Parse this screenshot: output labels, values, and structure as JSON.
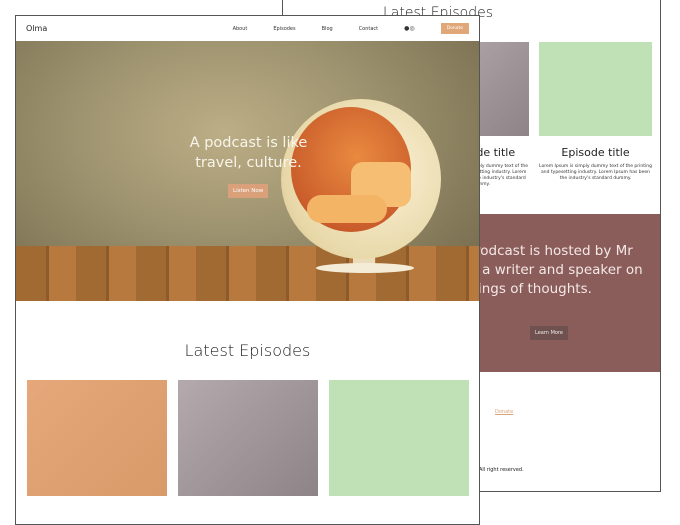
{
  "back_page": {
    "latest_title": "Latest Episodes",
    "episodes": [
      {
        "title": "Episode title",
        "desc": "Lorem Ipsum is simply dummy text of the printing and typesetting industry. Lorem Ipsum has been the industry's standard dummy."
      },
      {
        "title": "Episode title",
        "desc": "Lorem Ipsum is simply dummy text of the printing and typesetting industry. Lorem Ipsum has been the industry's standard dummy."
      }
    ],
    "about_text": "The Olma Podcast is hosted by Mr Name and is a writer and speaker on all things of thoughts.",
    "learn_more": "Learn More",
    "donate_link": "Donate",
    "rights": "All right reserved."
  },
  "front_page": {
    "logo": "Olma",
    "nav": [
      "About",
      "Episodes",
      "Blog",
      "Contact"
    ],
    "social_icon": "podcast-icon",
    "donate_button": "Donate",
    "hero_text": "A podcast is like travel, culture.",
    "listen_button": "Listen Now",
    "latest_title": "Latest Episodes"
  },
  "colors": {
    "accent": "#e0a878",
    "about_bg": "#8b5d5a",
    "card1": "#e6a77a",
    "card2": "#a89ea2",
    "card3": "#c0e0b5"
  }
}
